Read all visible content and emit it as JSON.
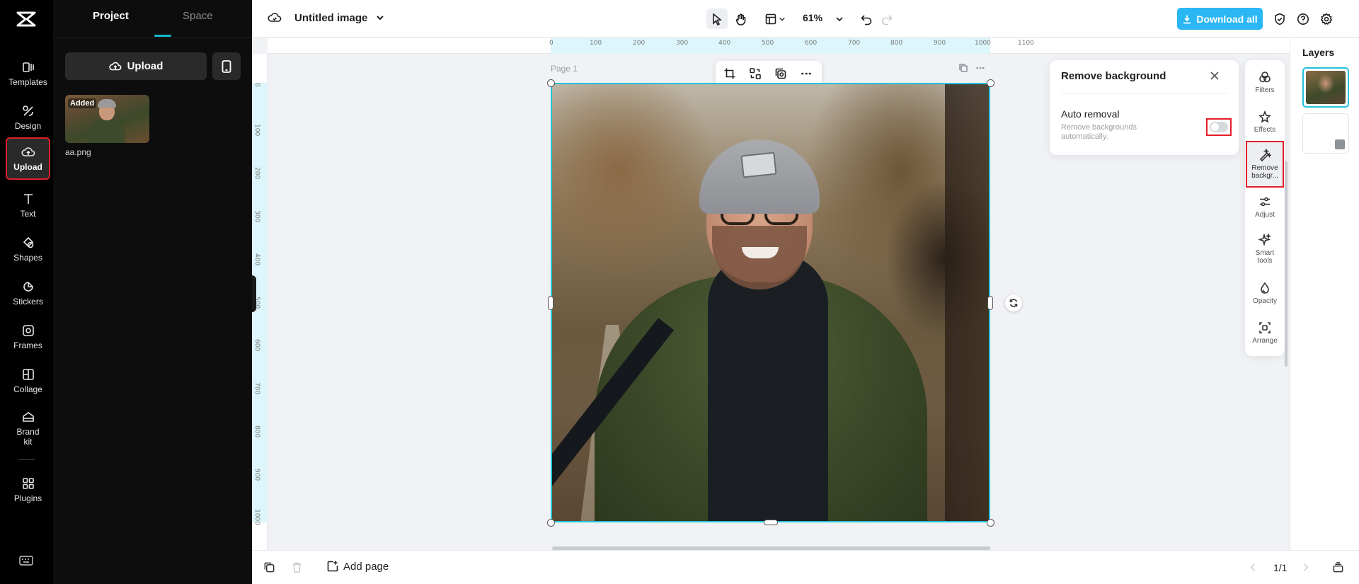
{
  "app": {
    "title": "Untitled image"
  },
  "rail": {
    "items": [
      {
        "label": "Templates"
      },
      {
        "label": "Design"
      },
      {
        "label": "Upload"
      },
      {
        "label": "Text"
      },
      {
        "label": "Shapes"
      },
      {
        "label": "Stickers"
      },
      {
        "label": "Frames"
      },
      {
        "label": "Collage"
      },
      {
        "label": "Brand kit"
      },
      {
        "label": "Plugins"
      }
    ]
  },
  "panel": {
    "tabs": [
      {
        "label": "Project"
      },
      {
        "label": "Space"
      }
    ],
    "upload_label": "Upload",
    "asset": {
      "badge": "Added",
      "name": "aa.png"
    }
  },
  "toolbar": {
    "zoom": "61%",
    "download_label": "Download all"
  },
  "canvas": {
    "page_label": "Page 1",
    "ruler_h": [
      "0",
      "100",
      "200",
      "300",
      "400",
      "500",
      "600",
      "700",
      "800",
      "900",
      "1000",
      "1100"
    ],
    "ruler_v": [
      "0",
      "100",
      "200",
      "300",
      "400",
      "500",
      "600",
      "700",
      "800",
      "900",
      "1000"
    ]
  },
  "remove_bg": {
    "title": "Remove background",
    "option_label": "Auto removal",
    "option_desc": "Remove backgrounds automatically.",
    "enabled": false
  },
  "tools": {
    "items": [
      {
        "label": "Filters"
      },
      {
        "label": "Effects"
      },
      {
        "label": "Remove backgr..."
      },
      {
        "label": "Adjust"
      },
      {
        "label": "Smart tools"
      },
      {
        "label": "Opacity"
      },
      {
        "label": "Arrange"
      }
    ]
  },
  "layers": {
    "title": "Layers"
  },
  "bottom": {
    "add_page_label": "Add page",
    "pager": "1/1"
  },
  "colors": {
    "accent": "#23c3da",
    "download": "#2bb6f4",
    "highlight": "#e21f2a"
  }
}
